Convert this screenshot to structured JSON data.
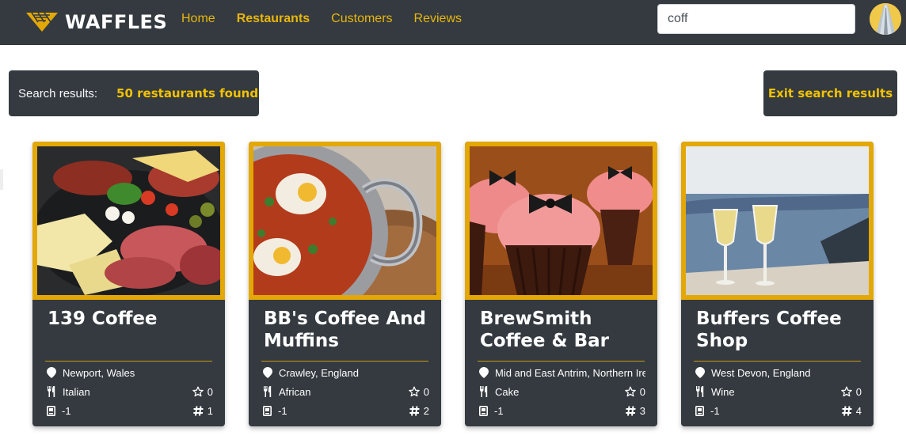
{
  "app": {
    "brand": "WAFFLES"
  },
  "nav": {
    "items": [
      {
        "label": "Home",
        "active": false
      },
      {
        "label": "Restaurants",
        "active": true
      },
      {
        "label": "Customers",
        "active": false
      },
      {
        "label": "Reviews",
        "active": false
      }
    ]
  },
  "search": {
    "value": "coff"
  },
  "results": {
    "label": "Search results:",
    "count_text": "50 restaurants found",
    "exit_label": "Exit search results"
  },
  "colors": {
    "nav_bg": "#343a40",
    "accent": "#f2c200",
    "card_border": "#e3a805"
  },
  "restaurants": [
    {
      "name": "139 Coffee",
      "location": "Newport, Wales",
      "cuisine": "Italian",
      "rating": "0",
      "reviews": "-1",
      "rank": "1",
      "image": "charcuterie-board"
    },
    {
      "name": "BB's Coffee And Muffins",
      "location": "Crawley, England",
      "cuisine": "African",
      "rating": "0",
      "reviews": "-1",
      "rank": "2",
      "image": "shakshuka-pan"
    },
    {
      "name": "BrewSmith Coffee & Bar",
      "location": "Mid and East Antrim, Northern Ireland",
      "cuisine": "Cake",
      "rating": "0",
      "reviews": "-1",
      "rank": "3",
      "image": "bow-cupcakes"
    },
    {
      "name": "Buffers Coffee Shop",
      "location": "West Devon, England",
      "cuisine": "Wine",
      "rating": "0",
      "reviews": "-1",
      "rank": "4",
      "image": "champagne-sea-view"
    }
  ]
}
